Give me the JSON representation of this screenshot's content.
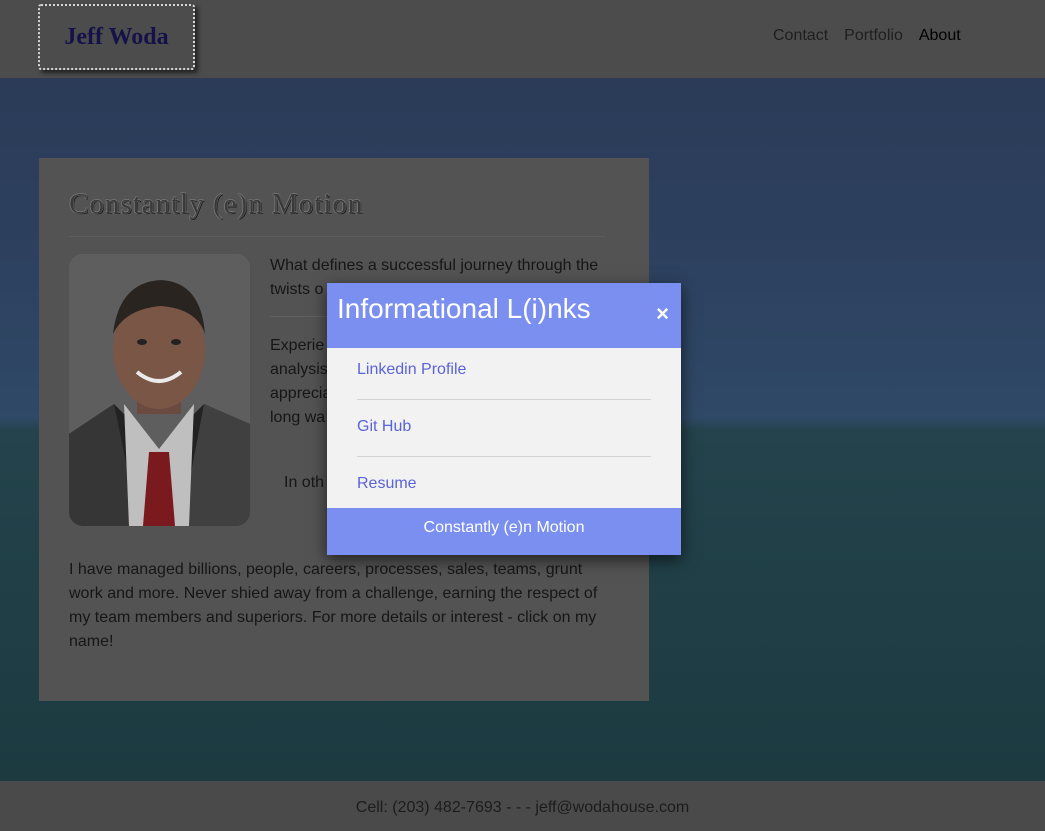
{
  "header": {
    "logo": "Jeff Woda",
    "nav": [
      "Contact",
      "Portfolio",
      "About"
    ]
  },
  "card": {
    "title": "Constantly (e)n Motion",
    "p1": "What defines a successful journey through the twists o",
    "p2_lines": [
      "Experie",
      "analysis",
      "apprecia",
      "long wa"
    ],
    "p3": "In oth",
    "p4": "I have managed billions, people, careers, processes, sales, teams, grunt work and more. Never shied away from a challenge, earning the respect of my team members and superiors. For more details or interest - click on my name!"
  },
  "modal": {
    "title": "Informational L(i)nks",
    "close": "×",
    "links": [
      "Linkedin Profile",
      "Git Hub",
      "Resume"
    ],
    "footer": "Constantly (e)n Motion"
  },
  "footer": {
    "contact": "Cell: (203) 482-7693 - - - jeff@wodahouse.com"
  }
}
